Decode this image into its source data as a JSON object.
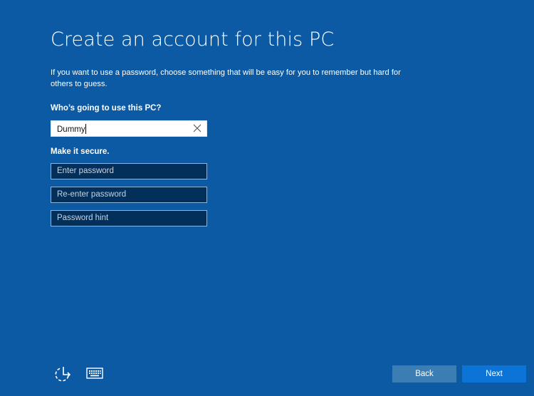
{
  "page": {
    "title": "Create an account for this PC",
    "description": "If you want to use a password, choose something that will be easy for you to remember but hard for others to guess."
  },
  "form": {
    "who_label": "Who’s going to use this PC?",
    "username": {
      "value": "Dummy",
      "clear_icon": "close-icon"
    },
    "secure_label": "Make it secure.",
    "password": {
      "value": "",
      "placeholder": "Enter password"
    },
    "reenter_password": {
      "value": "",
      "placeholder": "Re-enter password"
    },
    "password_hint": {
      "value": "",
      "placeholder": "Password hint"
    }
  },
  "footer": {
    "icons": [
      "ease-of-access-icon",
      "keyboard-icon"
    ],
    "back_label": "Back",
    "next_label": "Next"
  },
  "colors": {
    "background": "#0c5aa3",
    "back_button": "#3c7db4",
    "next_button": "#0c74d6",
    "dark_field": "#03305a"
  }
}
